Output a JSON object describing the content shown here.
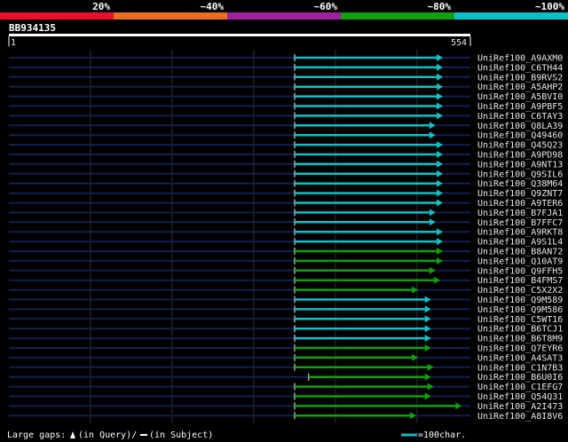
{
  "chart_data": {
    "type": "bar",
    "title": "",
    "query": {
      "id": "BB934135",
      "start": "1",
      "end": "554",
      "length": 554
    },
    "legend": [
      {
        "label": "20%",
        "color": "#e8102a"
      },
      {
        "label": "~40%",
        "color": "#e87020"
      },
      {
        "label": "~60%",
        "color": "#a020a0"
      },
      {
        "label": "~80%",
        "color": "#10a010"
      },
      {
        "label": "~100%",
        "color": "#10c0c8"
      }
    ],
    "hits": [
      {
        "name": "UniRef100_A9AXM0",
        "start": 1,
        "end": 554,
        "identity_class": "~100%"
      },
      {
        "name": "UniRef100_C6TH44",
        "start": 1,
        "end": 554,
        "identity_class": "~100%"
      },
      {
        "name": "UniRef100_B9RVS2",
        "start": 1,
        "end": 554,
        "identity_class": "~100%"
      },
      {
        "name": "UniRef100_A5AHP2",
        "start": 1,
        "end": 554,
        "identity_class": "~100%"
      },
      {
        "name": "UniRef100_A5BVI0",
        "start": 1,
        "end": 554,
        "identity_class": "~100%"
      },
      {
        "name": "UniRef100_A9PBF5",
        "start": 1,
        "end": 554,
        "identity_class": "~100%"
      },
      {
        "name": "UniRef100_C6TAY3",
        "start": 1,
        "end": 554,
        "identity_class": "~100%"
      },
      {
        "name": "UniRef100_Q8LA39",
        "start": 1,
        "end": 527,
        "identity_class": "~100%"
      },
      {
        "name": "UniRef100_Q49460",
        "start": 1,
        "end": 527,
        "identity_class": "~100%"
      },
      {
        "name": "UniRef100_Q45Q23",
        "start": 1,
        "end": 554,
        "identity_class": "~100%"
      },
      {
        "name": "UniRef100_A9PD98",
        "start": 1,
        "end": 554,
        "identity_class": "~100%"
      },
      {
        "name": "UniRef100_A9NT13",
        "start": 1,
        "end": 554,
        "identity_class": "~100%"
      },
      {
        "name": "UniRef100_Q9SIL6",
        "start": 1,
        "end": 554,
        "identity_class": "~100%"
      },
      {
        "name": "UniRef100_Q38M64",
        "start": 1,
        "end": 554,
        "identity_class": "~100%"
      },
      {
        "name": "UniRef100_Q9ZNT7",
        "start": 1,
        "end": 554,
        "identity_class": "~100%"
      },
      {
        "name": "UniRef100_A9TER6",
        "start": 1,
        "end": 554,
        "identity_class": "~100%"
      },
      {
        "name": "UniRef100_B7FJA1",
        "start": 1,
        "end": 527,
        "identity_class": "~100%"
      },
      {
        "name": "UniRef100_B7FFC7",
        "start": 1,
        "end": 527,
        "identity_class": "~100%"
      },
      {
        "name": "UniRef100_A9RKT8",
        "start": 1,
        "end": 554,
        "identity_class": "~100%"
      },
      {
        "name": "UniRef100_A9S1L4",
        "start": 1,
        "end": 554,
        "identity_class": "~100%"
      },
      {
        "name": "UniRef100_B8AN72",
        "start": 1,
        "end": 554,
        "identity_class": "~80%"
      },
      {
        "name": "UniRef100_Q10AT9",
        "start": 1,
        "end": 554,
        "identity_class": "~80%"
      },
      {
        "name": "UniRef100_Q9FFH5",
        "start": 1,
        "end": 527,
        "identity_class": "~80%"
      },
      {
        "name": "UniRef100_B4FMS7",
        "start": 1,
        "end": 544,
        "identity_class": "~80%"
      },
      {
        "name": "UniRef100_C5X2X2",
        "start": 1,
        "end": 462,
        "identity_class": "~80%"
      },
      {
        "name": "UniRef100_Q9M589",
        "start": 1,
        "end": 510,
        "identity_class": "~100%"
      },
      {
        "name": "UniRef100_Q9M586",
        "start": 1,
        "end": 510,
        "identity_class": "~100%"
      },
      {
        "name": "UniRef100_C5WT16",
        "start": 1,
        "end": 510,
        "identity_class": "~100%"
      },
      {
        "name": "UniRef100_B6TCJ1",
        "start": 1,
        "end": 510,
        "identity_class": "~100%"
      },
      {
        "name": "UniRef100_B6T8M9",
        "start": 1,
        "end": 510,
        "identity_class": "~100%"
      },
      {
        "name": "UniRef100_Q7EYR6",
        "start": 1,
        "end": 510,
        "identity_class": "~80%"
      },
      {
        "name": "UniRef100_A4SAT3",
        "start": 1,
        "end": 462,
        "identity_class": "~80%"
      },
      {
        "name": "UniRef100_C1N7B3",
        "start": 1,
        "end": 520,
        "identity_class": "~80%"
      },
      {
        "name": "UniRef100_B6U0I6",
        "start": 53,
        "end": 510,
        "identity_class": "~80%"
      },
      {
        "name": "UniRef100_C1EFG7",
        "start": 1,
        "end": 520,
        "identity_class": "~80%"
      },
      {
        "name": "UniRef100_Q54Q31",
        "start": 1,
        "end": 510,
        "identity_class": "~80%"
      },
      {
        "name": "UniRef100_A2I473",
        "start": 1,
        "end": 624,
        "identity_class": "~80%"
      },
      {
        "name": "UniRef100_A8I8V6",
        "start": 1,
        "end": 455,
        "identity_class": "~80%"
      }
    ],
    "footer": {
      "gaps_label": "Large gaps:",
      "gaps_text": "(in Query)/",
      "gaps_text2": "(in Subject)",
      "scale_label": "=100char."
    },
    "colors": {
      "background": "#000000",
      "row_line": "#102050",
      "grid": "#303030",
      "ruler": "#ffffff",
      "label": "#e8e8e8"
    }
  }
}
